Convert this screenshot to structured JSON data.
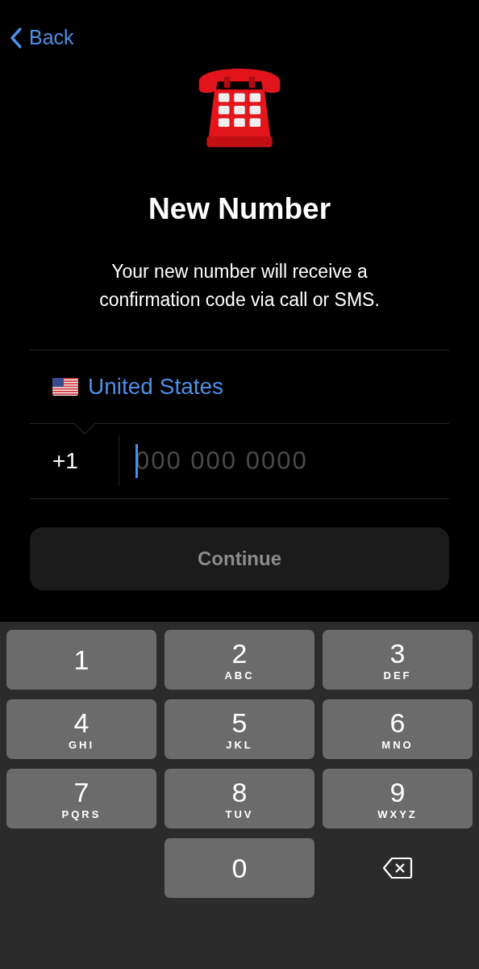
{
  "nav": {
    "back_label": "Back"
  },
  "title": "New Number",
  "subtitle": "Your new number will receive a confirmation code via call or SMS.",
  "country": {
    "name": "United States"
  },
  "phone": {
    "code": "+1",
    "placeholder": "000 000 0000",
    "focused": true
  },
  "continue_button": {
    "label": "Continue",
    "disabled": true
  },
  "keypad": [
    {
      "kind": "digit",
      "digit": "1"
    },
    {
      "kind": "digit",
      "digit": "2",
      "letters": "ABC"
    },
    {
      "kind": "digit",
      "digit": "3",
      "letters": "DEF"
    },
    {
      "kind": "digit",
      "digit": "4",
      "letters": "GHI"
    },
    {
      "kind": "digit",
      "digit": "5",
      "letters": "JKL"
    },
    {
      "kind": "digit",
      "digit": "6",
      "letters": "MNO"
    },
    {
      "kind": "digit",
      "digit": "7",
      "letters": "PQRS"
    },
    {
      "kind": "digit",
      "digit": "8",
      "letters": "TUV"
    },
    {
      "kind": "digit",
      "digit": "9",
      "letters": "WXYZ"
    },
    {
      "kind": "blank"
    },
    {
      "kind": "digit",
      "digit": "0"
    },
    {
      "kind": "delete"
    }
  ]
}
